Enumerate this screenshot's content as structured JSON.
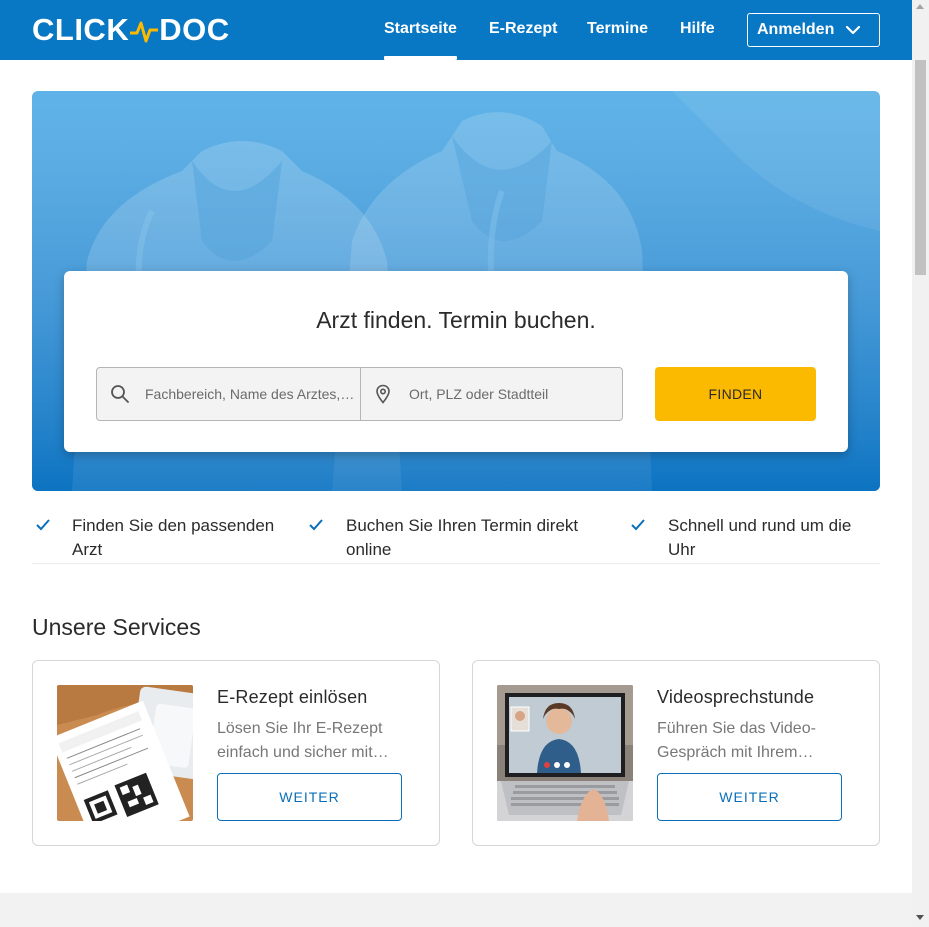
{
  "header": {
    "logo_left": "CLICK",
    "logo_right": "DOC",
    "nav": [
      {
        "label": "Startseite",
        "active": true
      },
      {
        "label": "E-Rezept",
        "active": false
      },
      {
        "label": "Termine",
        "active": false
      },
      {
        "label": "Hilfe",
        "active": false
      }
    ],
    "login_label": "Anmelden"
  },
  "search": {
    "title": "Arzt finden. Termin buchen.",
    "field1_placeholder": "Fachbereich, Name des Arztes, Praxis",
    "field2_placeholder": "Ort, PLZ oder Stadtteil",
    "find_label": "FINDEN"
  },
  "benefits": [
    {
      "line1": "Finden Sie den passenden",
      "line2": "Arzt"
    },
    {
      "line1": "Buchen Sie Ihren Termin direkt",
      "line2": "online"
    },
    {
      "line1": "Schnell und rund um die",
      "line2": "Uhr"
    }
  ],
  "services": {
    "title": "Unsere Services",
    "cards": [
      {
        "title": "E-Rezept einlösen",
        "desc_line1": "Lösen Sie Ihr E-Rezept",
        "desc_line2": "einfach und sicher mit…",
        "button": "WEITER",
        "image": "prescription-image"
      },
      {
        "title": "Videosprechstunde",
        "desc_line1": "Führen Sie das Video-",
        "desc_line2": "Gespräch mit Ihrem…",
        "button": "WEITER",
        "image": "video-call-image"
      }
    ]
  },
  "colors": {
    "header_bg": "#0877c4",
    "accent_yellow": "#fbb900",
    "link_blue": "#0a6fb8",
    "logo_pulse": "#fbb900"
  }
}
